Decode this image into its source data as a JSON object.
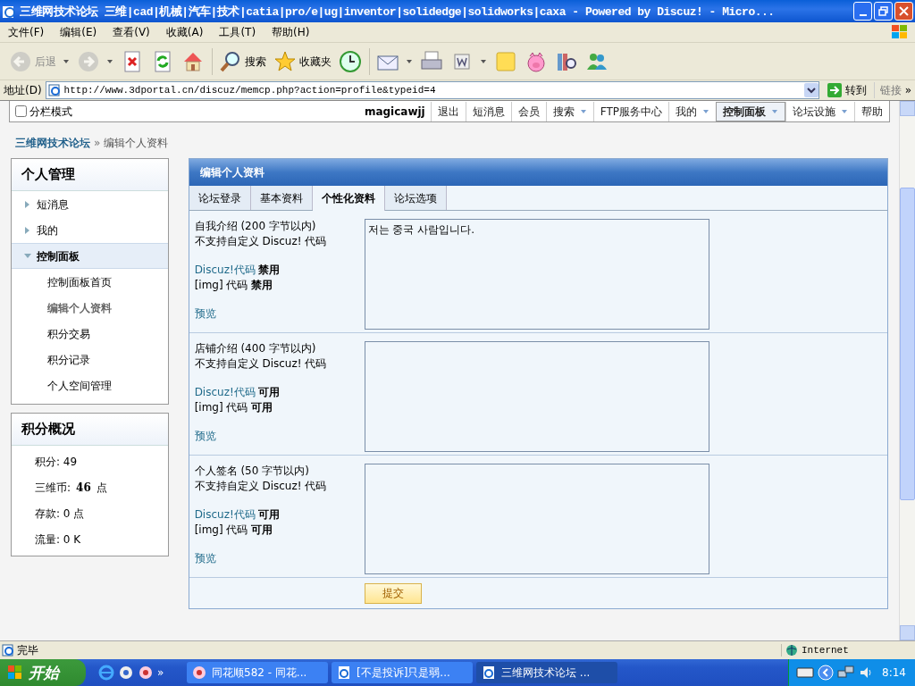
{
  "window": {
    "title": "三维网技术论坛 三维|cad|机械|汽车|技术|catia|pro/e|ug|inventor|solidedge|solidworks|caxa - Powered by Discuz! - Micro..."
  },
  "menu_bar": [
    "文件(F)",
    "编辑(E)",
    "查看(V)",
    "收藏(A)",
    "工具(T)",
    "帮助(H)"
  ],
  "toolbar": [
    {
      "kind": "back",
      "label": "后退",
      "dropdown": true,
      "disabled": true
    },
    {
      "kind": "forward",
      "dropdown": true,
      "disabled": true
    },
    {
      "kind": "stop"
    },
    {
      "kind": "refresh"
    },
    {
      "kind": "home"
    },
    {
      "kind": "search",
      "label": "搜索",
      "separator_before": true
    },
    {
      "kind": "favorites",
      "label": "收藏夹"
    },
    {
      "kind": "history"
    },
    {
      "kind": "mail",
      "dropdown": true,
      "separator_before": true
    },
    {
      "kind": "print"
    },
    {
      "kind": "edit",
      "dropdown": true
    },
    {
      "kind": "note"
    },
    {
      "kind": "piggy"
    },
    {
      "kind": "research"
    },
    {
      "kind": "contacts"
    }
  ],
  "address_bar": {
    "label": "地址(D)",
    "value": "http://www.3dportal.cn/discuz/memcp.php?action=profile&typeid=4",
    "go": "转到",
    "links": "链接",
    "more": "»"
  },
  "forum_nav": {
    "split_mode": {
      "label": "分栏模式",
      "checked": false
    },
    "username": "magicawjj",
    "items": [
      {
        "label": "退出",
        "dropdown": false,
        "selected": false
      },
      {
        "label": "短消息",
        "dropdown": false,
        "selected": false
      },
      {
        "label": "会员",
        "dropdown": false,
        "selected": false
      },
      {
        "label": "搜索",
        "dropdown": true,
        "selected": false
      },
      {
        "label": "FTP服务中心",
        "dropdown": false,
        "selected": false
      },
      {
        "label": "我的",
        "dropdown": true,
        "selected": false
      },
      {
        "label": "控制面板",
        "dropdown": true,
        "selected": true
      },
      {
        "label": "论坛设施",
        "dropdown": true,
        "selected": false
      },
      {
        "label": "帮助",
        "dropdown": false,
        "selected": false
      }
    ]
  },
  "breadcrumb": {
    "home": "三维网技术论坛",
    "separator": "»",
    "current": "编辑个人资料"
  },
  "sidebar": {
    "title": "个人管理",
    "items": [
      {
        "label": "短消息",
        "expanded": false,
        "selected": false
      },
      {
        "label": "我的",
        "expanded": false,
        "selected": false
      },
      {
        "label": "控制面板",
        "expanded": true,
        "selected": true,
        "children": [
          {
            "label": "控制面板首页",
            "selected": false
          },
          {
            "label": "编辑个人资料",
            "selected": true
          },
          {
            "label": "积分交易",
            "selected": false
          },
          {
            "label": "积分记录",
            "selected": false
          },
          {
            "label": "个人空间管理",
            "selected": false
          }
        ]
      }
    ]
  },
  "credits": {
    "title": "积分概况",
    "items": [
      "积分: 49",
      "三维币: **46** 点",
      "存款: 0 点",
      "流量: 0 K"
    ]
  },
  "profile_form": {
    "title": "编辑个人资料",
    "tabs": [
      {
        "label": "论坛登录",
        "selected": false
      },
      {
        "label": "基本资料",
        "selected": false
      },
      {
        "label": "个性化资料",
        "selected": true
      },
      {
        "label": "论坛选项",
        "selected": false
      }
    ],
    "fields": [
      {
        "label": "自我介绍 (200 字节以内)",
        "note": "不支持自定义 Discuz! 代码",
        "code_link": "Discuz!代码",
        "code_status": "禁用",
        "img_code": "[img] 代码 **禁用**",
        "preview": "预览",
        "value": "저는 중국 사람입니다."
      },
      {
        "label": "店铺介绍 (400 字节以内)",
        "note": "不支持自定义 Discuz! 代码",
        "code_link": "Discuz!代码",
        "code_status": "可用",
        "img_code": "[img] 代码 **可用**",
        "preview": "预览"
      },
      {
        "label": "个人签名 (50 字节以内)",
        "note": "不支持自定义 Discuz! 代码",
        "code_link": "Discuz!代码",
        "code_status": "可用",
        "img_code": "[img] 代码 **可用**",
        "preview": "预览"
      }
    ],
    "submit": "提交"
  },
  "status_bar": {
    "text": "完毕",
    "zone": "Internet"
  },
  "taskbar": {
    "start": "开始",
    "more": "»",
    "tasks": [
      {
        "label": "同花顺582 - 同花...",
        "kind": "app",
        "selected": false
      },
      {
        "label": "[不是投诉]只是弱...",
        "kind": "browser",
        "selected": false
      },
      {
        "label": "三维网技术论坛 ...",
        "kind": "browser",
        "selected": true
      }
    ],
    "clock": "8:14"
  }
}
